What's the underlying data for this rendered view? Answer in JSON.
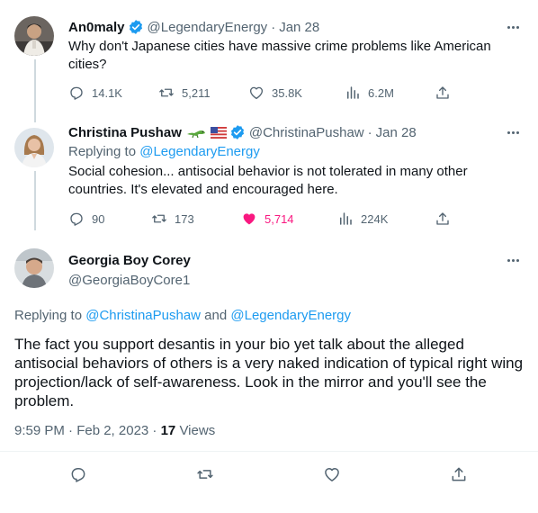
{
  "colors": {
    "accent": "#1d9bf0",
    "muted": "#536471",
    "like": "#f91880",
    "text": "#0f1419"
  },
  "tweet1": {
    "name": "An0maly",
    "handle": "@LegendaryEnergy",
    "dot": "·",
    "date": "Jan 28",
    "text": "Why don't Japanese cities have massive crime problems like American cities?",
    "stats": {
      "replies": "14.1K",
      "retweets": "5,211",
      "likes": "35.8K",
      "views": "6.2M"
    }
  },
  "tweet2": {
    "name": "Christina Pushaw",
    "handle": "@ChristinaPushaw",
    "dot": "·",
    "date": "Jan 28",
    "replying_prefix": "Replying to ",
    "replying_handle": "@LegendaryEnergy",
    "text": "Social cohesion... antisocial behavior is not tolerated in many other countries. It's elevated and encouraged here.",
    "stats": {
      "replies": "90",
      "retweets": "173",
      "likes": "5,714",
      "views": "224K"
    }
  },
  "tweet3": {
    "name": "Georgia Boy Corey",
    "handle": "@GeorgiaBoyCore1",
    "replying_prefix": "Replying to ",
    "replying_handle_1": "@ChristinaPushaw",
    "replying_and": " and ",
    "replying_handle_2": "@LegendaryEnergy",
    "text": "The fact you support desantis in your bio yet talk about the alleged antisocial behaviors of others is a very naked indication of typical right wing projection/lack of self-awareness. Look in the mirror and you'll see the problem.",
    "timestamp": "9:59 PM · Feb 2, 2023 · ",
    "views_count": "17",
    "views_label": " Views"
  },
  "icons": [
    "verified-badge-icon",
    "more-icon",
    "reply-icon",
    "retweet-icon",
    "like-icon",
    "views-icon",
    "share-icon",
    "lizard-emoji-icon",
    "us-flag-icon"
  ]
}
